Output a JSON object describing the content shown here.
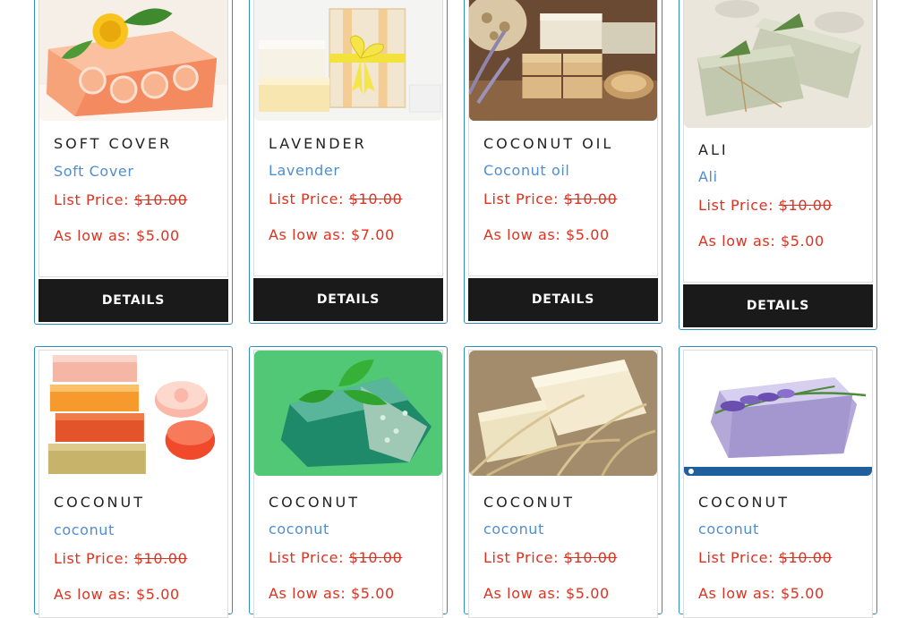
{
  "products": [
    {
      "title": "SOFT COVER",
      "subtitle": "Soft Cover",
      "list_label": "List Price:",
      "list_price": "$10.00",
      "low_label": "As low as:",
      "low_price": "$5.00",
      "button": "DETAILS"
    },
    {
      "title": "LAVENDER",
      "subtitle": "Lavender",
      "list_label": "List Price:",
      "list_price": "$10.00",
      "low_label": "As low as:",
      "low_price": "$7.00",
      "button": "DETAILS"
    },
    {
      "title": "COCONUT OIL",
      "subtitle": "Coconut oil",
      "list_label": "List Price:",
      "list_price": "$10.00",
      "low_label": "As low as:",
      "low_price": "$5.00",
      "button": "DETAILS"
    },
    {
      "title": "ALI",
      "subtitle": "Ali",
      "list_label": "List Price:",
      "list_price": "$10.00",
      "low_label": "As low as:",
      "low_price": "$5.00",
      "button": "DETAILS"
    },
    {
      "title": "COCONUT",
      "subtitle": "coconut",
      "list_label": "List Price:",
      "list_price": "$10.00",
      "low_label": "As low as:",
      "low_price": "$5.00"
    },
    {
      "title": "COCONUT",
      "subtitle": "coconut",
      "list_label": "List Price:",
      "list_price": "$10.00",
      "low_label": "As low as:",
      "low_price": "$5.00"
    },
    {
      "title": "COCONUT",
      "subtitle": "coconut",
      "list_label": "List Price:",
      "list_price": "$10.00",
      "low_label": "As low as:",
      "low_price": "$5.00"
    },
    {
      "title": "COCONUT",
      "subtitle": "coconut",
      "list_label": "List Price:",
      "list_price": "$10.00",
      "low_label": "As low as:",
      "low_price": "$5.00"
    }
  ],
  "colors": {
    "card_border": "#2e8fbd",
    "title": "#222222",
    "subtitle": "#4f8fd0",
    "price": "#e0311f",
    "button_bg": "#1a1a1a",
    "button_text": "#ffffff"
  }
}
